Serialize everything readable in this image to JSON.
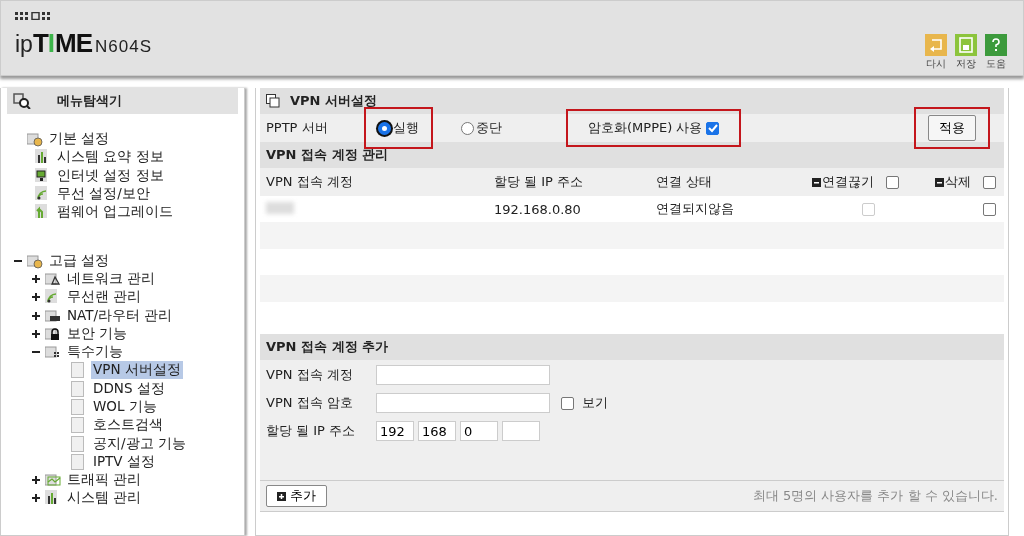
{
  "header": {
    "logo": [
      {
        "text": "ip",
        "kind": "light"
      },
      {
        "text": "T",
        "kind": "bold"
      },
      {
        "text": "I",
        "kind": "accent"
      },
      {
        "text": "ME",
        "kind": "bold"
      },
      {
        "text": "N604S",
        "kind": "model"
      }
    ],
    "buttons": [
      {
        "label": "다시",
        "kind": "undo",
        "color": "#e8b64c"
      },
      {
        "label": "저장",
        "kind": "save",
        "color": "#8cc43c"
      },
      {
        "label": "도움",
        "kind": "help",
        "color": "#3c9a3c"
      }
    ]
  },
  "sidebar": {
    "title": "메뉴탐색기",
    "tree": [
      {
        "label": "기본 설정",
        "kind": "folder",
        "children": [
          {
            "label": "시스템 요약 정보",
            "kind": "chart",
            "selected": false
          },
          {
            "label": "인터넷 설정 정보",
            "kind": "monitor",
            "selected": false
          },
          {
            "label": "무선 설정/보안",
            "kind": "wifi",
            "selected": false
          },
          {
            "label": "펌웨어 업그레이드",
            "kind": "upgrade",
            "selected": false
          }
        ]
      },
      {
        "label": "고급 설정",
        "kind": "folder",
        "expanded": true,
        "children": [
          {
            "label": "네트워크 관리",
            "kind": "network",
            "expanded": false
          },
          {
            "label": "무선랜 관리",
            "kind": "wifi",
            "expanded": false
          },
          {
            "label": "NAT/라우터 관리",
            "kind": "router",
            "expanded": false
          },
          {
            "label": "보안 기능",
            "kind": "lock",
            "expanded": false
          },
          {
            "label": "특수기능",
            "kind": "dots",
            "expanded": true,
            "children": [
              {
                "label": "VPN 서버설정",
                "kind": "page",
                "selected": true
              },
              {
                "label": "DDNS 설정",
                "kind": "page",
                "selected": false
              },
              {
                "label": "WOL 기능",
                "kind": "page",
                "selected": false
              },
              {
                "label": "호스트검색",
                "kind": "page",
                "selected": false
              },
              {
                "label": "공지/광고 기능",
                "kind": "page",
                "selected": false
              },
              {
                "label": "IPTV 설정",
                "kind": "page",
                "selected": false
              }
            ]
          },
          {
            "label": "트래픽 관리",
            "kind": "traffic",
            "expanded": false
          },
          {
            "label": "시스템 관리",
            "kind": "chart",
            "expanded": false
          }
        ]
      }
    ]
  },
  "main": {
    "title": "VPN 서버설정",
    "pptp": {
      "label": "PPTP 서버",
      "options": [
        {
          "label": "실행",
          "selected": true,
          "highlighted": true
        },
        {
          "label": "중단",
          "selected": false,
          "highlighted": false
        }
      ],
      "encryption": {
        "label": "암호화(MPPE) 사용",
        "checked": true,
        "highlighted": true
      },
      "apply": {
        "label": "적용",
        "highlighted": true
      }
    },
    "accounts": {
      "title": "VPN 접속 계정 관리",
      "columns": [
        {
          "label": "VPN 접속 계정"
        },
        {
          "label": "할당 될 IP 주소"
        },
        {
          "label": "연결 상태"
        },
        {
          "label": "연결끊기",
          "checked": false
        },
        {
          "label": "삭제",
          "checked": false
        }
      ],
      "rows": [
        {
          "redacted": true,
          "ip": "192.168.0.80",
          "status": "연결되지않음",
          "disconnect": {
            "checked": false,
            "disabled": true
          },
          "delete": {
            "checked": false,
            "disabled": false
          }
        }
      ]
    },
    "add": {
      "title": "VPN 접속 계정 추가",
      "account_label": "VPN 접속 계정",
      "password_label": "VPN 접속 암호",
      "show_label": "보기",
      "show_checked": false,
      "ip_label": "할당 될 IP 주소",
      "ip": [
        "192",
        "168",
        "0"
      ],
      "add_button": "추가",
      "note": "최대 5명의 사용자를 추가 할 수 있습니다."
    }
  }
}
